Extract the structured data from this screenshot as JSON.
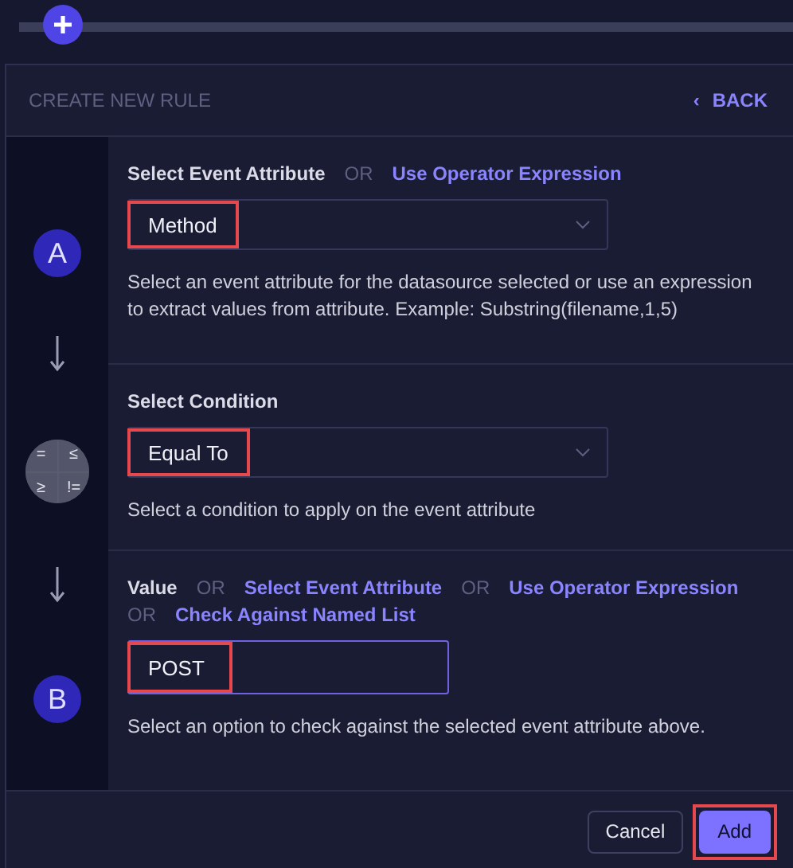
{
  "header": {
    "title": "CREATE NEW RULE",
    "back": {
      "icon": "‹",
      "label": "BACK"
    }
  },
  "steps": [
    {
      "kind": "letter",
      "label": "A"
    },
    {
      "kind": "operators",
      "symbols": [
        "=",
        "≤",
        "≥",
        "!="
      ]
    },
    {
      "kind": "letter",
      "label": "B"
    }
  ],
  "sections": [
    {
      "kind": "select",
      "title": "Select Event Attribute",
      "options": [
        {
          "kind": "or",
          "text": "OR"
        },
        {
          "kind": "link",
          "text": "Use Operator Expression"
        }
      ],
      "value": "Method",
      "highlighted": true,
      "help": "Select an event attribute for the datasource selected or use an expression to extract values from attribute. Example: Substring(filename,1,5)"
    },
    {
      "kind": "select",
      "title": "Select Condition",
      "value": "Equal To",
      "highlighted": true,
      "help": "Select a condition to apply on the event attribute"
    },
    {
      "kind": "input",
      "title": "Value",
      "options": [
        {
          "kind": "or",
          "text": "OR"
        },
        {
          "kind": "link",
          "text": "Select Event Attribute"
        },
        {
          "kind": "or",
          "text": "OR"
        },
        {
          "kind": "link",
          "text": "Use Operator Expression"
        },
        {
          "kind": "or",
          "text": "OR"
        },
        {
          "kind": "link",
          "text": "Check Against Named List"
        }
      ],
      "value": "POST",
      "highlighted": true,
      "help": "Select an option to check against the selected event attribute above."
    }
  ],
  "footer": {
    "cancel": "Cancel",
    "add": {
      "label": "Add",
      "highlighted": true
    }
  }
}
